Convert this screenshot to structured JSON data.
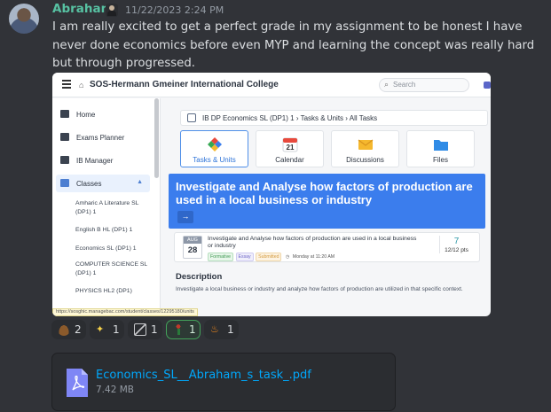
{
  "message": {
    "author": "Abraham",
    "timestamp": "11/22/2023 2:24 PM",
    "text": "I am really excited to get a perfect grade in my assignment to be honest I have never done economics before even MYP and learning the concept was really hard but through progressed."
  },
  "screenshot": {
    "school_name": "SOS-Hermann Gmeiner International College",
    "search_placeholder": "Search",
    "sidebar": {
      "home": "Home",
      "exams_planner": "Exams Planner",
      "ib_manager": "IB Manager",
      "classes": "Classes",
      "classes_list": [
        "Amharic A Literature SL (DP1) 1",
        "English B HL (DP1) 1",
        "Economics SL (DP1) 1",
        "COMPUTER SCIENCE SL (DP1) 1",
        "PHYSICS HL2 (DP1)"
      ]
    },
    "status_url": "https://sosghic.managebac.com/student/classes/12295180/units",
    "breadcrumb": {
      "class": "IB DP Economics SL (DP1) 1",
      "section": "Tasks & Units",
      "page": "All Tasks"
    },
    "tiles": [
      "Tasks & Units",
      "Calendar",
      "Discussions",
      "Files"
    ],
    "calendar_day": "21",
    "banner_title": "Investigate and Analyse how factors of production are used in a local business or industry",
    "banner_button": "→",
    "task": {
      "month": "AUG",
      "day": "28",
      "title": "Investigate and Analyse how factors of production are used in a local business or industry",
      "tags": [
        "Formative",
        "Essay",
        "Submitted"
      ],
      "due": "Monday at 11:20 AM",
      "score": "7",
      "points": "12/12 pts"
    },
    "description_heading": "Description",
    "description_text": "Investigate a local business or industry and analyze how factors of production are utilized in that specific context."
  },
  "reactions": [
    {
      "emoji": "cowboy-hat-emoji",
      "count": "2",
      "reacted": false
    },
    {
      "emoji": "sparkles-emoji",
      "count": "1",
      "reacted": false
    },
    {
      "emoji": "picture-frame-emoji",
      "count": "1",
      "reacted": false
    },
    {
      "emoji": "person-emoji",
      "count": "1",
      "reacted": true
    },
    {
      "emoji": "fire-emoji",
      "count": "1",
      "reacted": false
    }
  ],
  "attachment": {
    "filename": "Economics_SL__Abraham_s_task_.pdf",
    "size": "7.42 MB"
  },
  "colors": {
    "background": "#313338",
    "username": "#57c1a2",
    "link": "#00a8fc",
    "banner": "#3b7ded",
    "reacted_border": "#43a25a"
  }
}
